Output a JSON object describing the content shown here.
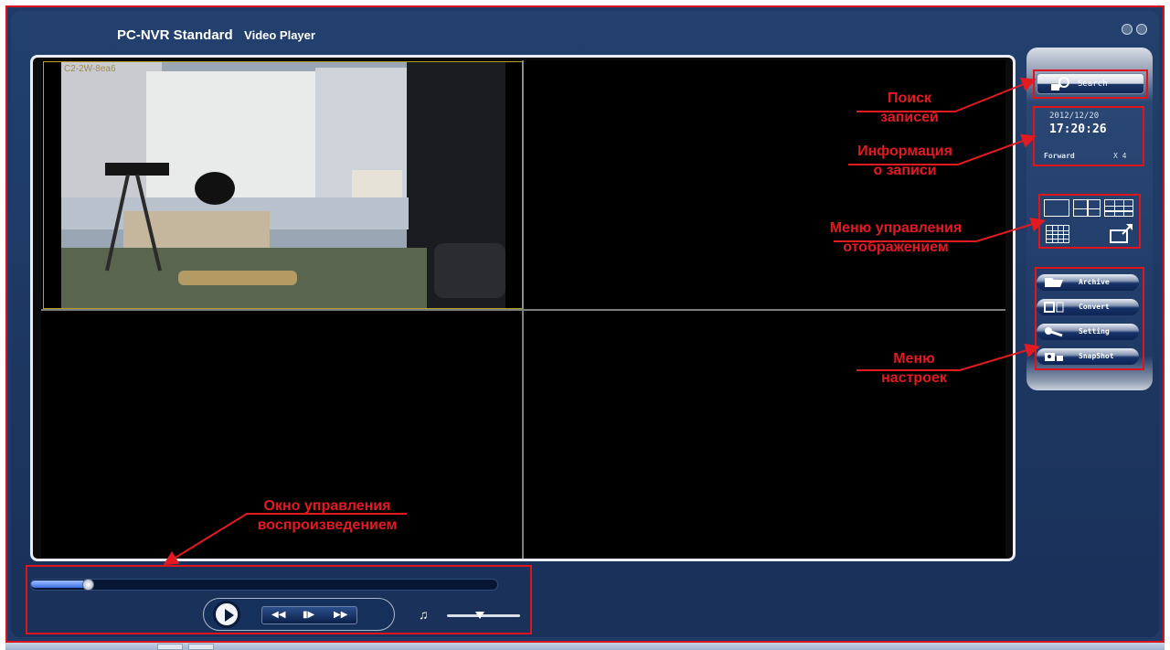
{
  "window": {
    "title_main": "PC-NVR Standard",
    "title_sub": "Video Player"
  },
  "video": {
    "camera_label": "C2-2W-8ea6"
  },
  "sidebar": {
    "search_label": "Search",
    "date": "2012/12/20",
    "time": "17:20:26",
    "direction": "Forward",
    "speed": "X 4",
    "menu": [
      {
        "label": "Archive",
        "icon": "folder-icon"
      },
      {
        "label": "Convert",
        "icon": "convert-icon"
      },
      {
        "label": "Setting",
        "icon": "wrench-icon"
      },
      {
        "label": "SnapShot",
        "icon": "camera-icon"
      }
    ]
  },
  "playback": {
    "progress": 0.12,
    "volume": 0.45
  },
  "annotations": {
    "search_line1": "Поиск",
    "search_line2": "записей",
    "info_line1": "Информация",
    "info_line2": "о записи",
    "display_line1": "Меню управления",
    "display_line2": "отображением",
    "settings_line1": "Меню",
    "settings_line2": "настроек",
    "playback_line1": "Окно управления",
    "playback_line2": "воспроизведением"
  },
  "colors": {
    "annotation": "#e21a22",
    "app_bg": "#1f3a66"
  }
}
